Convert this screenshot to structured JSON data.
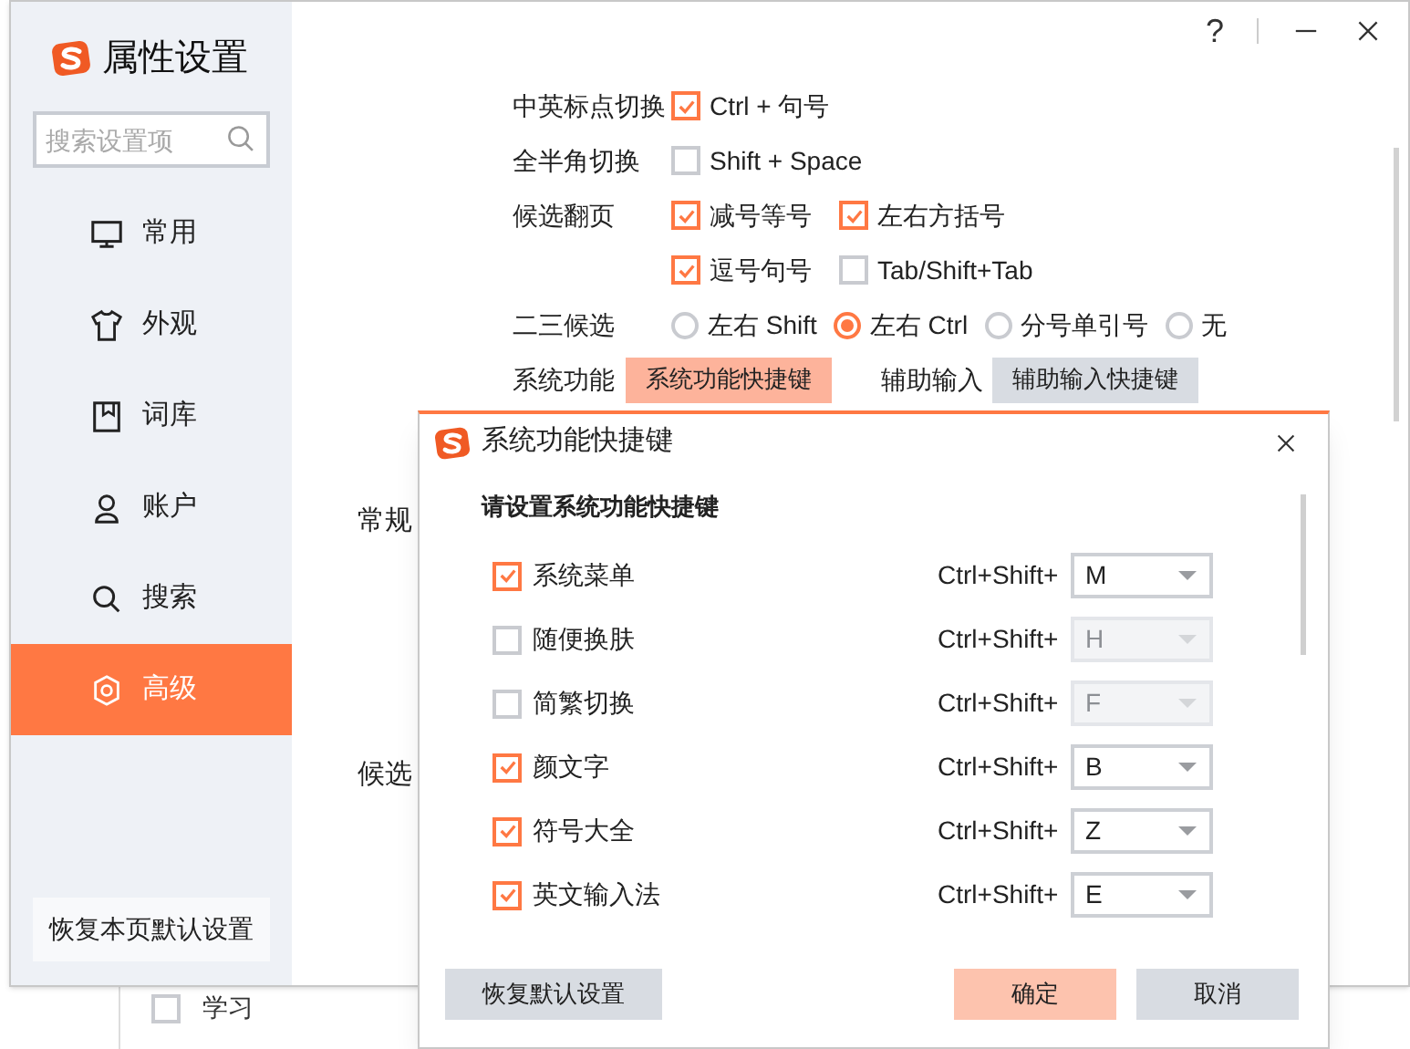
{
  "window": {
    "title": "属性设置",
    "help": "?"
  },
  "search": {
    "placeholder": "搜索设置项"
  },
  "sidebar": {
    "items": [
      {
        "label": "常用",
        "selected": false
      },
      {
        "label": "外观",
        "selected": false
      },
      {
        "label": "词库",
        "selected": false
      },
      {
        "label": "账户",
        "selected": false
      },
      {
        "label": "搜索",
        "selected": false
      },
      {
        "label": "高级",
        "selected": true
      }
    ],
    "reset_button": "恢复本页默认设置"
  },
  "settings": [
    {
      "label": "中英标点切换",
      "options": [
        {
          "kind": "checkbox",
          "label": "Ctrl + 句号",
          "checked": true
        }
      ]
    },
    {
      "label": "全半角切换",
      "options": [
        {
          "kind": "checkbox",
          "label": "Shift + Space",
          "checked": false
        }
      ]
    },
    {
      "label": "候选翻页",
      "options": [
        {
          "kind": "checkbox",
          "label": "减号等号",
          "checked": true
        },
        {
          "kind": "checkbox",
          "label": "左右方括号",
          "checked": true
        }
      ]
    },
    {
      "options": [
        {
          "kind": "checkbox",
          "label": "逗号句号",
          "checked": true
        },
        {
          "kind": "checkbox",
          "label": "Tab/Shift+Tab",
          "checked": false
        }
      ]
    },
    {
      "label": "二三候选",
      "options": [
        {
          "kind": "radio",
          "label": "左右 Shift",
          "selected": false
        },
        {
          "kind": "radio",
          "label": "左右 Ctrl",
          "selected": true
        },
        {
          "kind": "radio",
          "label": "分号单引号",
          "selected": false
        },
        {
          "kind": "radio",
          "label": "无",
          "selected": false
        }
      ]
    },
    {
      "label": "系统功能",
      "options": [
        {
          "kind": "button",
          "label": "系统功能快捷键",
          "selected": true
        },
        {
          "kind": "text",
          "label": "辅助输入"
        },
        {
          "kind": "button",
          "label": "辅助输入快捷键",
          "selected": false
        }
      ]
    }
  ],
  "sections": [
    "常规",
    "候选"
  ],
  "dialog": {
    "title": "系统功能快捷键",
    "heading": "请设置系统功能快捷键",
    "rows": [
      {
        "label": "系统菜单",
        "checked": true,
        "modifier": "Ctrl+Shift+",
        "key": "M"
      },
      {
        "label": "随便换肤",
        "checked": false,
        "modifier": "Ctrl+Shift+",
        "key": "H"
      },
      {
        "label": "简繁切换",
        "checked": false,
        "modifier": "Ctrl+Shift+",
        "key": "F"
      },
      {
        "label": "颜文字",
        "checked": true,
        "modifier": "Ctrl+Shift+",
        "key": "B"
      },
      {
        "label": "符号大全",
        "checked": true,
        "modifier": "Ctrl+Shift+",
        "key": "Z"
      },
      {
        "label": "英文输入法",
        "checked": true,
        "modifier": "Ctrl+Shift+",
        "key": "E"
      }
    ],
    "buttons": [
      {
        "kind": "reset",
        "label": "恢复默认设置"
      },
      {
        "kind": "primary",
        "label": "确定"
      },
      {
        "kind": "secondary",
        "label": "取消"
      }
    ]
  },
  "background": {
    "items": [
      {
        "label": "学习",
        "checked": false
      }
    ]
  }
}
